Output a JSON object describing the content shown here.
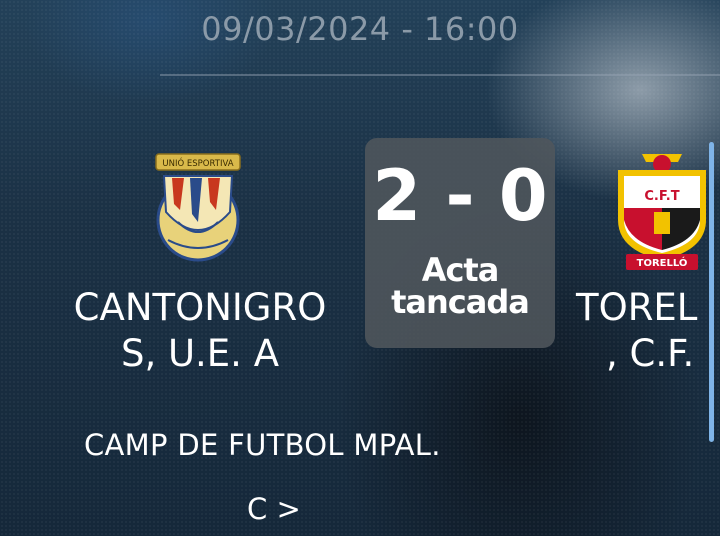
{
  "match": {
    "datetime": "09/03/2024 - 16:00",
    "score": "2 - 0",
    "status_line1": "Acta",
    "status_line2": "tancada"
  },
  "home_team": {
    "name_line1": "CANTONIGRO",
    "name_line2": "S, U.E. A",
    "crest_text": "UNIÓ ESPORTIVA"
  },
  "away_team": {
    "name_line1": "TOREL",
    "name_line2": ", C.F.",
    "crest_text_top": "C.F.T",
    "crest_text_bottom": "TORELLÓ"
  },
  "venue": {
    "name": "CAMP DE FUTBOL MPAL.",
    "more_label": "C >"
  },
  "colors": {
    "score_box": "#50565c",
    "crest_away_red": "#c8102e",
    "crest_away_yellow": "#f2c200",
    "scrollbar": "#7fb4e8"
  }
}
